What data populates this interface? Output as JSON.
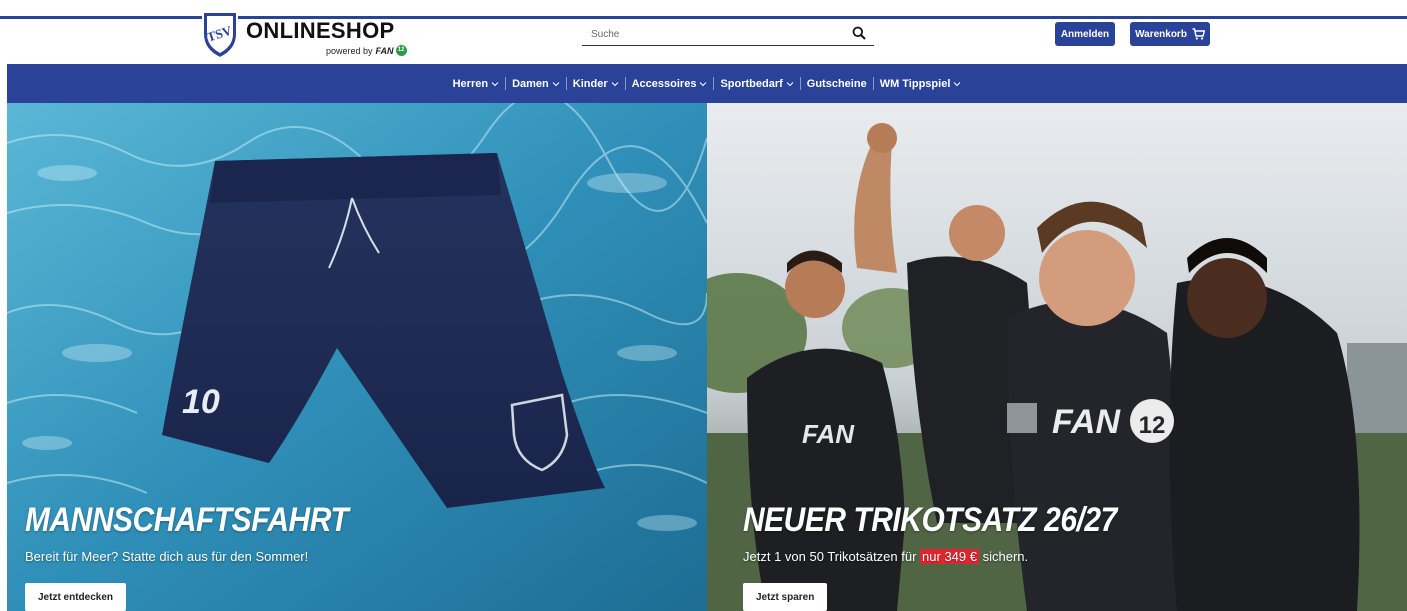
{
  "header": {
    "logo_title": "ONLINESHOP",
    "logo_sub": "powered by",
    "logo_sub_brand": "FAN",
    "logo_sub_badge": "12",
    "crest_text": "TSV",
    "search_placeholder": "Suche",
    "login_label": "Anmelden",
    "cart_label": "Warenkorb"
  },
  "nav": {
    "items": [
      {
        "label": "Herren",
        "has_dropdown": true
      },
      {
        "label": "Damen",
        "has_dropdown": true
      },
      {
        "label": "Kinder",
        "has_dropdown": true
      },
      {
        "label": "Accessoires",
        "has_dropdown": true
      },
      {
        "label": "Sportbedarf",
        "has_dropdown": true
      },
      {
        "label": "Gutscheine",
        "has_dropdown": false
      },
      {
        "label": "WM Tippspiel",
        "has_dropdown": true
      }
    ]
  },
  "banners": {
    "left": {
      "title": "MANNSCHAFTSFAHRT",
      "subtitle": "Bereit für Meer? Statte dich aus für den Sommer!",
      "button": "Jetzt entdecken",
      "shorts_number": "10"
    },
    "right": {
      "title": "NEUER TRIKOTSATZ 26/27",
      "subtitle_before": "Jetzt 1 von 50 Trikotsätzen für",
      "subtitle_highlight": "nur 349 €",
      "subtitle_after": "sichern.",
      "button": "Jetzt sparen",
      "shirt_brand": "FAN",
      "shirt_number": "12"
    }
  },
  "colors": {
    "brand_blue": "#2b4299",
    "highlight_red": "#e2262f",
    "pool_blue": "#2f8fb8",
    "shorts_navy": "#1d2a4f"
  }
}
